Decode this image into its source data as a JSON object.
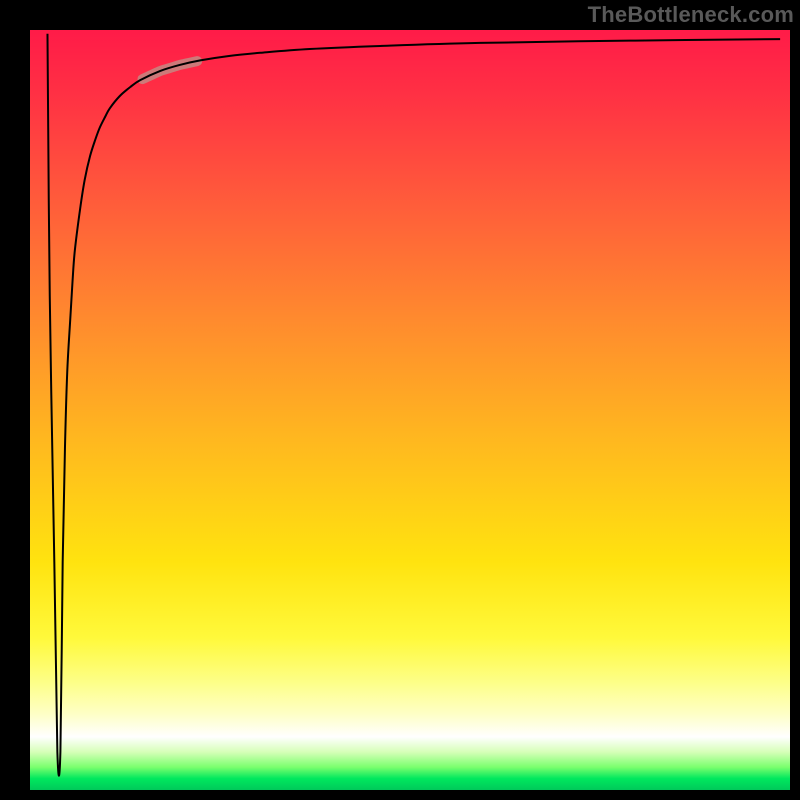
{
  "watermark": {
    "text": "TheBottleneck.com"
  },
  "colors": {
    "frame": "#000000",
    "watermark_text": "#595959",
    "curve": "#000000",
    "highlight": "#c48882",
    "gradient_stops": [
      "#ff1b48",
      "#ff2f44",
      "#ff5a3b",
      "#ff8a2e",
      "#ffb81f",
      "#ffe30f",
      "#fff93b",
      "#fdff8a",
      "#feffc6",
      "#ffffff",
      "#d6ffb8",
      "#7aff6e",
      "#00e85e",
      "#00c95a"
    ]
  },
  "chart_data": {
    "type": "line",
    "title": "",
    "xlabel": "",
    "ylabel": "",
    "xlim": [
      0,
      100
    ],
    "ylim": [
      0,
      100
    ],
    "grid": false,
    "legend": false,
    "series": [
      {
        "name": "bottleneck-curve",
        "x": [
          2.3,
          2.6,
          3.2,
          3.6,
          4.0,
          4.3,
          4.6,
          4.9,
          5.3,
          5.6,
          5.9,
          6.6,
          7.2,
          7.9,
          8.6,
          9.2,
          9.9,
          10.5,
          11.8,
          13.2,
          14.5,
          17.1,
          19.7,
          22.4,
          26.3,
          30.3,
          36.8,
          46.1,
          59.2,
          78.9,
          98.7
        ],
        "y": [
          99.5,
          65.0,
          30.0,
          5.0,
          5.0,
          30.0,
          45.0,
          55.0,
          62.0,
          67.0,
          71.0,
          76.5,
          80.3,
          83.4,
          85.6,
          87.2,
          88.6,
          89.7,
          91.3,
          92.5,
          93.4,
          94.6,
          95.4,
          96.0,
          96.6,
          97.0,
          97.5,
          97.9,
          98.3,
          98.6,
          98.8
        ]
      }
    ],
    "highlight_segment": {
      "series": "bottleneck-curve",
      "x_range": [
        14.8,
        22.0
      ],
      "y_range": [
        80.0,
        87.0
      ]
    },
    "background": "vertical-rainbow-gradient"
  }
}
